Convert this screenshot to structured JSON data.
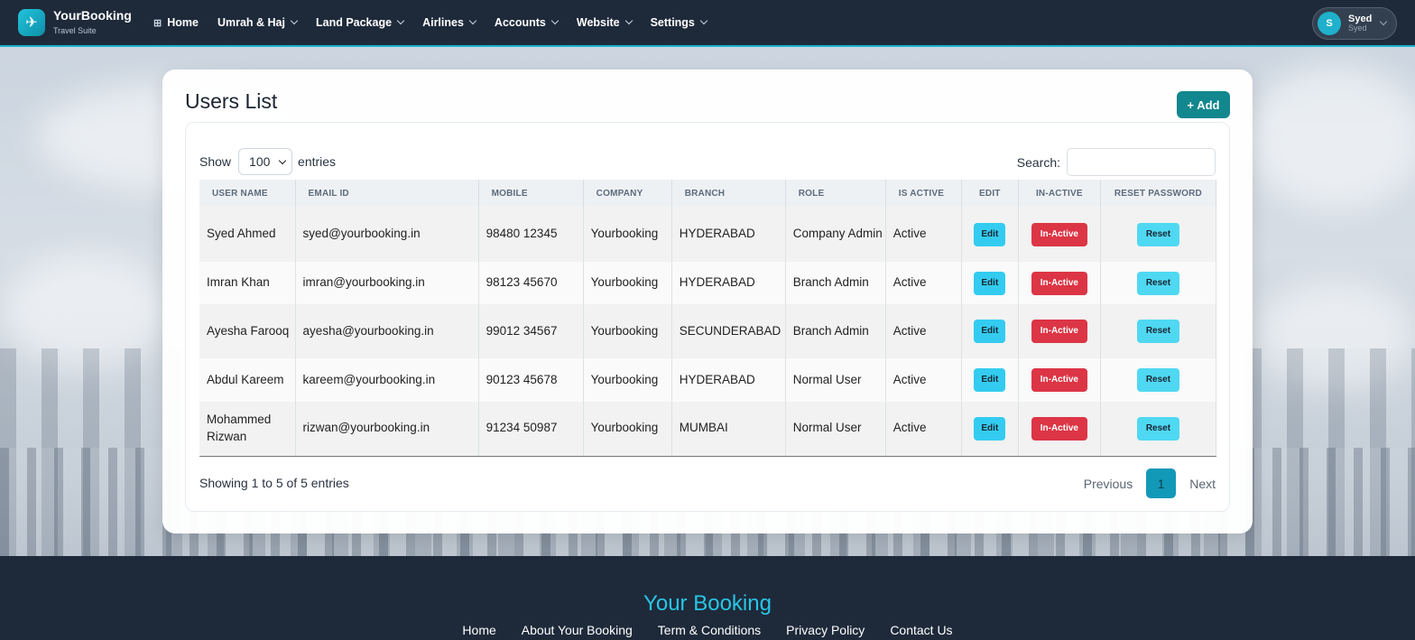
{
  "brand": {
    "name": "YourBooking",
    "subtitle": "Travel Suite"
  },
  "nav": [
    {
      "label": "Home",
      "dropdown": false,
      "icon": "grid-icon"
    },
    {
      "label": "Umrah & Haj",
      "dropdown": true
    },
    {
      "label": "Land Package",
      "dropdown": true
    },
    {
      "label": "Airlines",
      "dropdown": true
    },
    {
      "label": "Accounts",
      "dropdown": true
    },
    {
      "label": "Website",
      "dropdown": true
    },
    {
      "label": "Settings",
      "dropdown": true
    }
  ],
  "user": {
    "initial": "S",
    "name": "Syed",
    "role": "Syed"
  },
  "page": {
    "title": "Users List",
    "add_label": "+ Add"
  },
  "controls": {
    "show_label": "Show",
    "entries_value": "100",
    "entries_label": "entries",
    "search_label": "Search:",
    "search_value": ""
  },
  "table": {
    "headers": [
      "USER NAME",
      "EMAIL ID",
      "MOBILE",
      "COMPANY",
      "BRANCH",
      "ROLE",
      "IS ACTIVE",
      "EDIT",
      "IN-ACTIVE",
      "RESET PASSWORD"
    ],
    "rows": [
      {
        "name": "Syed Ahmed",
        "email": "syed@yourbooking.in",
        "mobile": "98480 12345",
        "company": "Yourbooking",
        "branch": "HYDERABAD",
        "role": "Company Admin",
        "active": "Active",
        "edit": "Edit",
        "inactive": "In-Active",
        "reset": "Reset"
      },
      {
        "name": "Imran Khan",
        "email": "imran@yourbooking.in",
        "mobile": "98123 45670",
        "company": "Yourbooking",
        "branch": "HYDERABAD",
        "role": "Branch Admin",
        "active": "Active",
        "edit": "Edit",
        "inactive": "In-Active",
        "reset": "Reset"
      },
      {
        "name": "Ayesha Farooq",
        "email": "ayesha@yourbooking.in",
        "mobile": "99012 34567",
        "company": "Yourbooking",
        "branch": "SECUNDERABAD",
        "role": "Branch Admin",
        "active": "Active",
        "edit": "Edit",
        "inactive": "In-Active",
        "reset": "Reset"
      },
      {
        "name": "Abdul Kareem",
        "email": "kareem@yourbooking.in",
        "mobile": "90123 45678",
        "company": "Yourbooking",
        "branch": "HYDERABAD",
        "role": "Normal User",
        "active": "Active",
        "edit": "Edit",
        "inactive": "In-Active",
        "reset": "Reset"
      },
      {
        "name": "Mohammed Rizwan",
        "email": "rizwan@yourbooking.in",
        "mobile": "91234 50987",
        "company": "Yourbooking",
        "branch": "MUMBAI",
        "role": "Normal User",
        "active": "Active",
        "edit": "Edit",
        "inactive": "In-Active",
        "reset": "Reset"
      }
    ]
  },
  "pagination": {
    "info": "Showing 1 to 5 of 5 entries",
    "previous": "Previous",
    "current": "1",
    "next": "Next"
  },
  "footer": {
    "title": "Your Booking",
    "links": [
      "Home",
      "About Your Booking",
      "Term & Conditions",
      "Privacy Policy",
      "Contact Us"
    ]
  },
  "colors": {
    "accent": "#12878e",
    "header_bg": "#1e2a3a",
    "danger": "#dc3545",
    "info": "#33ccf0",
    "footer_title": "#29c5e6"
  }
}
